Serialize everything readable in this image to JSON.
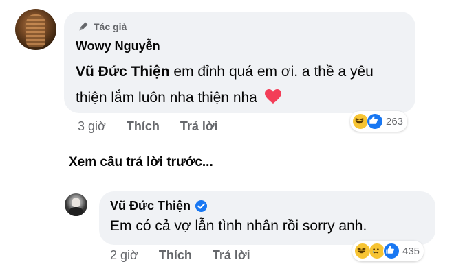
{
  "main_comment": {
    "badge": "Tác giả",
    "author": "Wowy Nguyễn",
    "mention": "Vũ Đức Thiện",
    "text": " em đỉnh quá em ơi. a thề a yêu thiện lắm luôn nha thiện nha",
    "time": "3 giờ",
    "like_label": "Thích",
    "reply_label": "Trả lời",
    "reaction_count": "263"
  },
  "view_previous": "Xem câu trả lời trước...",
  "reply_comment": {
    "author": "Vũ Đức Thiện",
    "text": "Em có cả vợ lẫn tình nhân rồi sorry anh.",
    "time": "2 giờ",
    "like_label": "Thích",
    "reply_label": "Trả lời",
    "reaction_count": "435"
  },
  "colors": {
    "bubble": "#f0f2f5",
    "meta_text": "#65676b",
    "like_blue": "#1877f2",
    "heart_red": "#f33e58"
  },
  "icons": [
    "pen-icon",
    "heart-emoji-icon",
    "haha-reaction-icon",
    "sad-reaction-icon",
    "like-reaction-icon",
    "verified-badge-icon"
  ]
}
